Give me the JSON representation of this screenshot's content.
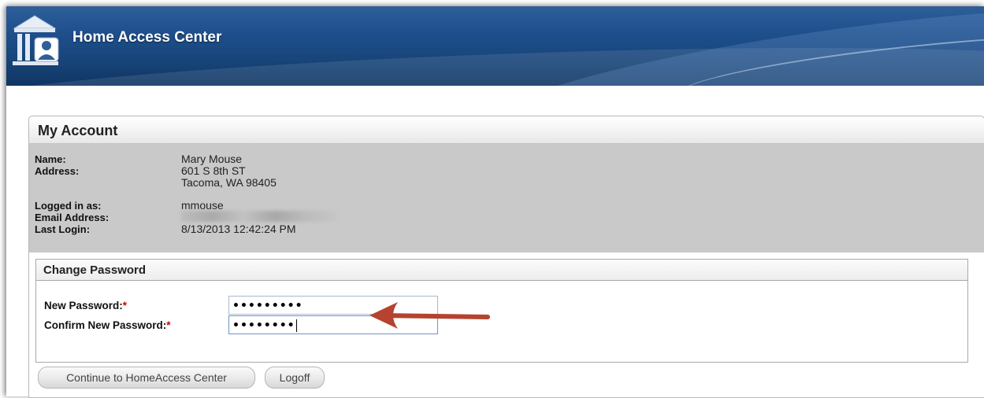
{
  "header": {
    "app_title": "Home Access Center",
    "logo_icon": "building-person-icon"
  },
  "account": {
    "title": "My Account",
    "name_label": "Name:",
    "name_value": "Mary Mouse",
    "address_label": "Address:",
    "address_line1": "601 S 8th ST",
    "address_line2": "Tacoma, WA 98405",
    "logged_in_label": "Logged in as:",
    "logged_in_value": "mmouse",
    "email_label": "Email Address:",
    "last_login_label": "Last Login:",
    "last_login_value": "8/13/2013 12:42:24 PM"
  },
  "change_password": {
    "title": "Change Password",
    "new_password_label": "New Password:",
    "confirm_password_label": "Confirm New Password:",
    "required_marker": "*",
    "new_password_value": "•••••••••",
    "confirm_password_value": "••••••••"
  },
  "buttons": {
    "continue_label": "Continue to HomeAccess Center",
    "logoff_label": "Logoff"
  },
  "colors": {
    "banner": "#1e4f8c",
    "info_background": "#c9c9c9",
    "required": "#cc0000",
    "arrow": "#b5432f"
  }
}
